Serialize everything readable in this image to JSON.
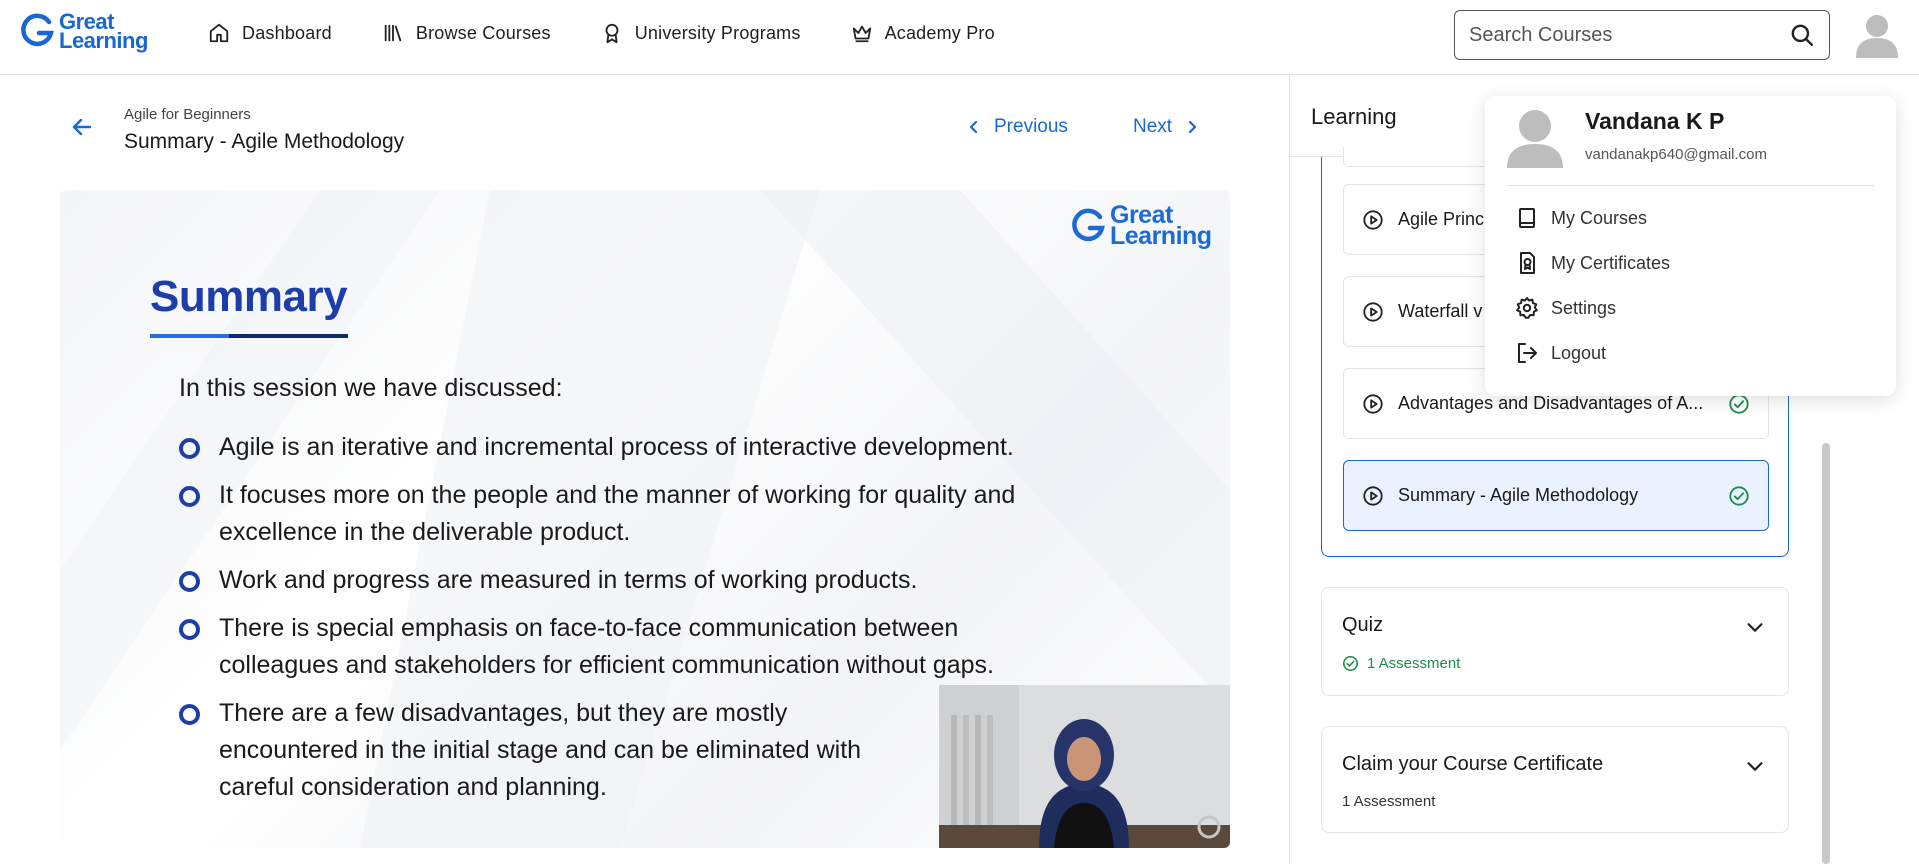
{
  "brand": {
    "line1": "Great",
    "line2": "Learning",
    "color": "#1967d2"
  },
  "nav": {
    "items": [
      {
        "label": "Dashboard",
        "icon": "home-icon"
      },
      {
        "label": "Browse Courses",
        "icon": "library-icon"
      },
      {
        "label": "University Programs",
        "icon": "award-icon"
      },
      {
        "label": "Academy Pro",
        "icon": "crown-icon"
      }
    ]
  },
  "search": {
    "placeholder": "Search Courses",
    "value": ""
  },
  "lesson_header": {
    "breadcrumb": "Agile for Beginners",
    "title": "Summary - Agile Methodology",
    "previous_label": "Previous",
    "next_label": "Next"
  },
  "slide": {
    "logo_line1": "Great",
    "logo_line2": "Learning",
    "heading": "Summary",
    "intro": "In this session we have discussed:",
    "bullets": [
      "Agile is an iterative and incremental process of interactive development.",
      "It focuses more on the people and the manner of working for quality and excellence in the deliverable product.",
      "Work and progress are measured in terms of working products.",
      "There is special emphasis on face-to-face communication between colleagues and stakeholders for efficient communication without gaps.",
      "There are a few disadvantages, but they are mostly encountered in the initial stage and can be eliminated with careful consideration and planning."
    ]
  },
  "sidebar": {
    "title": "Learning",
    "lessons": [
      {
        "label": "Agile Princ",
        "completed": false,
        "active": false
      },
      {
        "label": "Waterfall v",
        "completed": false,
        "active": false
      },
      {
        "label": "Advantages and Disadvantages of A...",
        "completed": true,
        "active": false
      },
      {
        "label": "Summary - Agile Methodology",
        "completed": true,
        "active": true
      }
    ],
    "sections": [
      {
        "title": "Quiz",
        "subtitle": "1 Assessment",
        "completed": true
      },
      {
        "title": "Claim your Course Certificate",
        "subtitle": "1 Assessment",
        "completed": false
      }
    ]
  },
  "profile_menu": {
    "name": "Vandana K P",
    "email": "vandanakp640@gmail.com",
    "items": [
      {
        "label": "My Courses",
        "icon": "book-icon"
      },
      {
        "label": "My Certificates",
        "icon": "certificate-icon"
      },
      {
        "label": "Settings",
        "icon": "gear-icon"
      },
      {
        "label": "Logout",
        "icon": "logout-icon"
      }
    ]
  },
  "colors": {
    "accent": "#1967d2",
    "success": "#1e8a4c",
    "slide_heading": "#1d3ea8"
  }
}
